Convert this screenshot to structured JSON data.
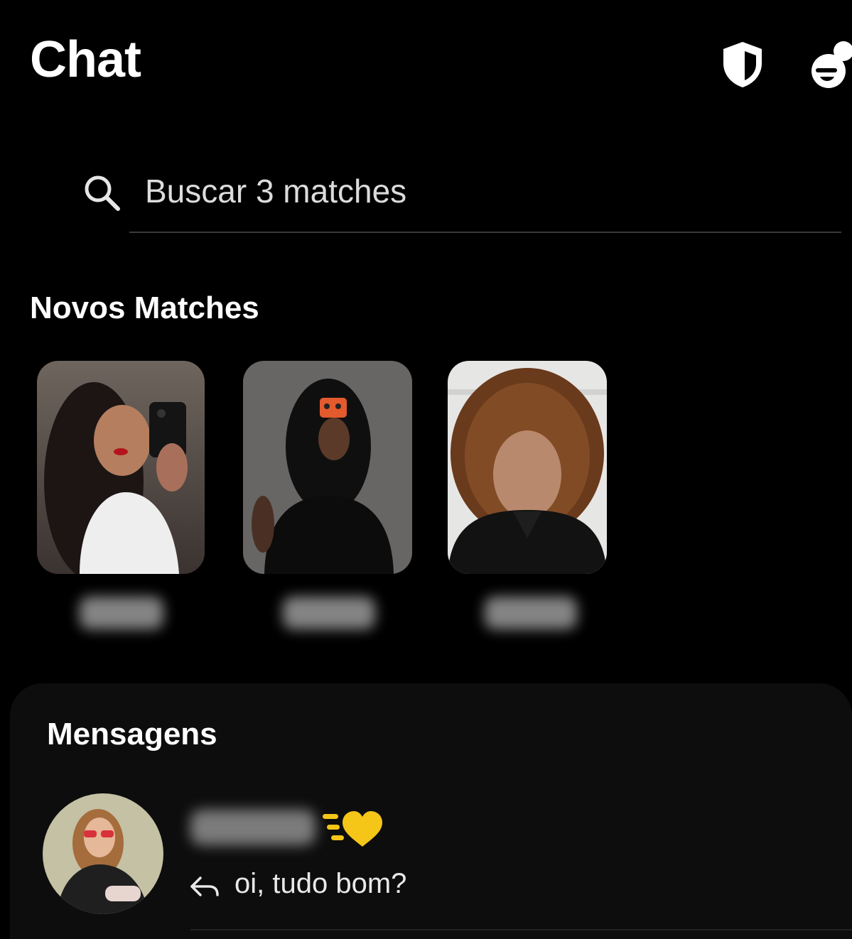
{
  "header": {
    "title": "Chat",
    "icons": [
      "shield-icon",
      "lobby-icon"
    ]
  },
  "search": {
    "placeholder": "Buscar 3 matches",
    "icon": "search-icon"
  },
  "new_matches": {
    "title": "Novos Matches",
    "items": [
      {
        "photo": "woman-curly-hair-white-top-mirror-selfie",
        "name_hidden": true
      },
      {
        "photo": "woman-black-top-mirror-selfie-face-covered",
        "name_hidden": true
      },
      {
        "photo": "woman-curly-brown-hair-black-shirt",
        "name_hidden": true
      }
    ]
  },
  "messages": {
    "title": "Mensagens",
    "conversations": [
      {
        "avatar": "woman-red-sunglasses-leather-jacket",
        "name_hidden": true,
        "badge_icon": "super-like-heart-icon",
        "reply_icon": "reply-arrow-icon",
        "preview": "oi, tudo bom?"
      }
    ]
  },
  "colors": {
    "background": "#000000",
    "panel": "#0d0d0d",
    "text": "#ffffff",
    "secondary_text": "#dcdcdc",
    "accent_gold": "#f5c518"
  }
}
